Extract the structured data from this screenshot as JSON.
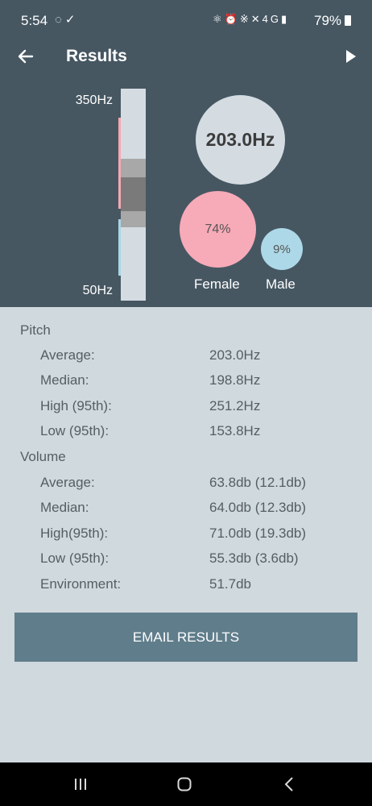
{
  "status_bar": {
    "time": "5:54",
    "left_icons": [
      "game-controller-icon",
      "check-circle-icon"
    ],
    "right_icons": [
      "key-icon",
      "alarm-icon",
      "bluetooth-icon",
      "mute-icon",
      "4g-icon",
      "signal-icon"
    ],
    "network": "4G",
    "battery": "79%"
  },
  "appbar": {
    "title": "Results"
  },
  "pitch_scale": {
    "top_label": "350Hz",
    "bottom_label": "50Hz"
  },
  "summary": {
    "average_pitch": "203.0Hz",
    "female_percent": "74%",
    "male_percent": "9%",
    "female_label": "Female",
    "male_label": "Male"
  },
  "pitch": {
    "heading": "Pitch",
    "rows": [
      {
        "label": "Average:",
        "value": "203.0Hz"
      },
      {
        "label": "Median:",
        "value": "198.8Hz"
      },
      {
        "label": "High (95th):",
        "value": "251.2Hz"
      },
      {
        "label": "Low (95th):",
        "value": "153.8Hz"
      }
    ]
  },
  "volume": {
    "heading": "Volume",
    "rows": [
      {
        "label": "Average:",
        "value": "63.8db (12.1db)"
      },
      {
        "label": "Median:",
        "value": "64.0db (12.3db)"
      },
      {
        "label": "High(95th):",
        "value": "71.0db (19.3db)"
      },
      {
        "label": "Low (95th):",
        "value": "55.3db (3.6db)"
      },
      {
        "label": "Environment:",
        "value": "51.7db"
      }
    ]
  },
  "email_button": {
    "label": "EMAIL RESULTS"
  },
  "colors": {
    "header_bg": "#465762",
    "content_bg": "#d0d9de",
    "female": "#f7aab8",
    "male": "#add8e8",
    "button": "#607d8b"
  }
}
